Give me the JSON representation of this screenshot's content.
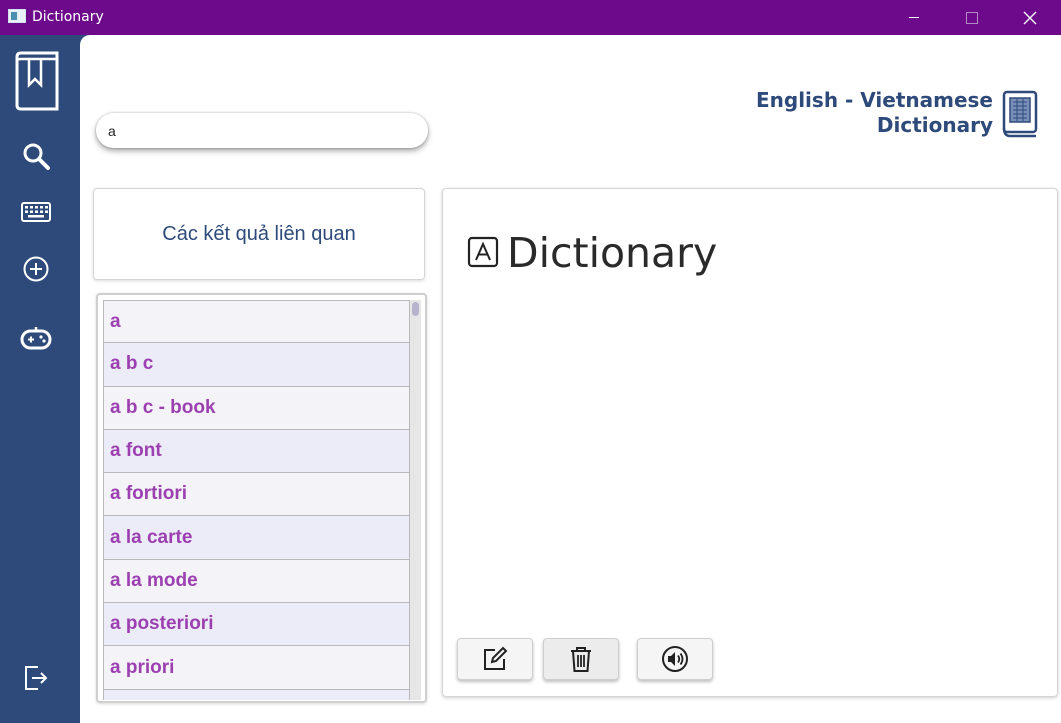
{
  "window": {
    "title": "Dictionary"
  },
  "sidebar": {
    "items": [
      {
        "name": "bookmark",
        "icon": "bookmark-book-icon"
      },
      {
        "name": "search",
        "icon": "search-icon"
      },
      {
        "name": "keyboard",
        "icon": "keyboard-icon"
      },
      {
        "name": "add",
        "icon": "add-circle-icon"
      },
      {
        "name": "game",
        "icon": "gamepad-icon"
      },
      {
        "name": "exit",
        "icon": "exit-icon"
      }
    ]
  },
  "search": {
    "value": "a"
  },
  "brand": {
    "line1": "English - Vietnamese",
    "line2": "Dictionary"
  },
  "related": {
    "label": "Các kết quả liên quan"
  },
  "results": [
    "a",
    "a b c",
    "a b c - book",
    "a font",
    "a fortiori",
    "a la carte",
    "a la mode",
    "a posteriori",
    "a priori",
    ""
  ],
  "detail": {
    "title": "Dictionary"
  },
  "colors": {
    "titlebar": "#6c0a8b",
    "sidebar": "#2e4a7a",
    "word_text": "#9c3fb0",
    "brand_text": "#2e4a7a"
  }
}
